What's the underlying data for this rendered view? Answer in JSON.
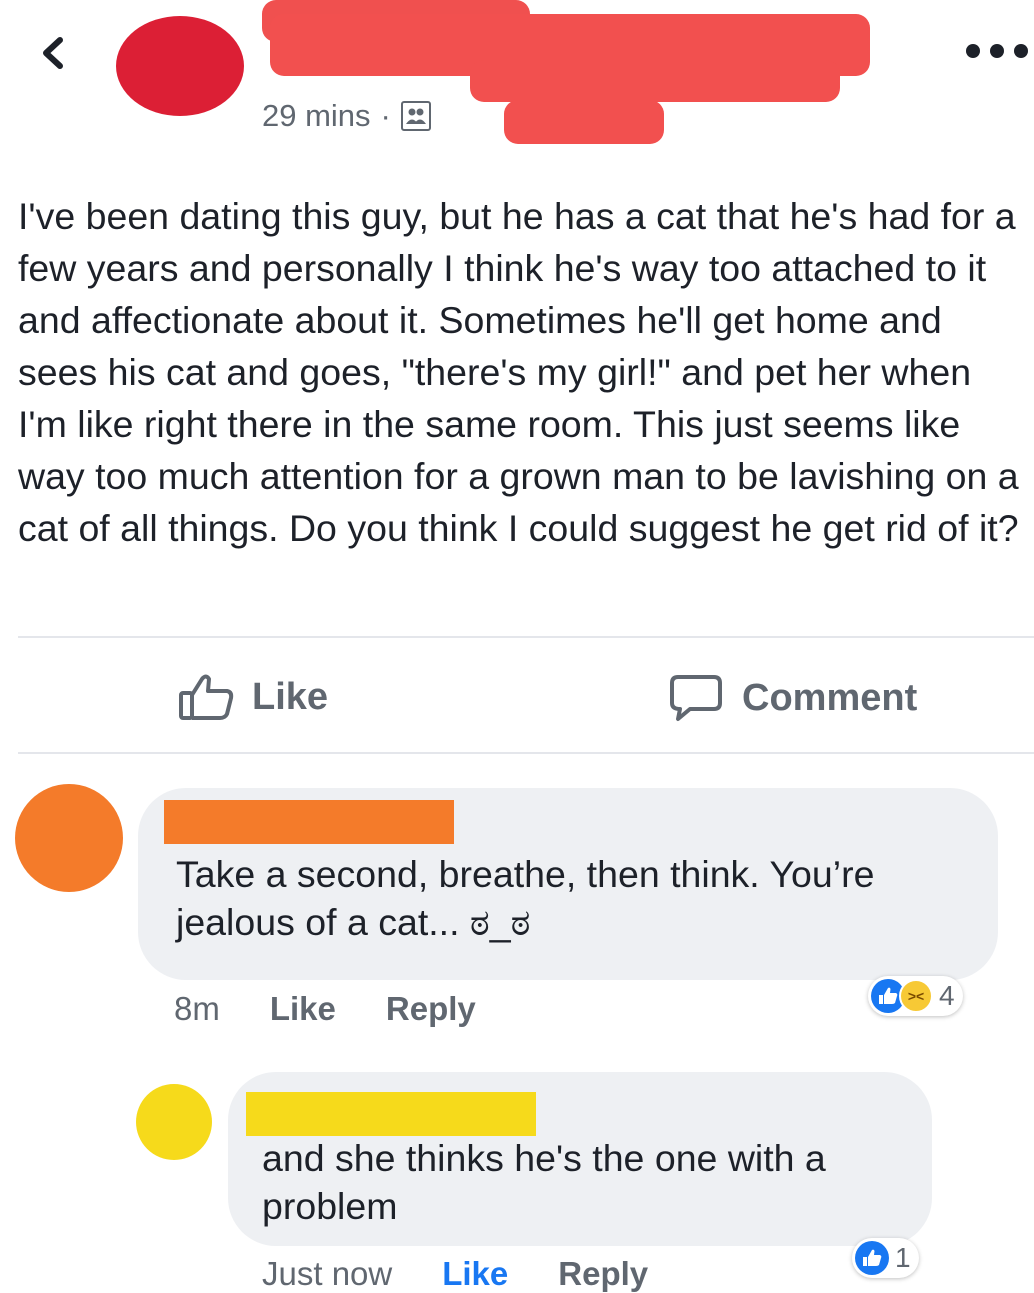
{
  "post": {
    "time": "29 mins",
    "separator": "·",
    "audience_icon": "friends-icon",
    "text": "I've been dating this guy, but he has a cat that he's had for a few years and personally I think he's way too attached to it and affectionate about it. Sometimes he'll get home and sees his cat and goes, \"there's my girl!\" and pet her when I'm like right there in the same room. This just seems like way too much attention for a grown man to be lavishing on a cat of all things. Do you think I could suggest he get rid of it?",
    "actions": {
      "like_label": "Like",
      "comment_label": "Comment"
    }
  },
  "comments": [
    {
      "text": "Take a second, breathe, then think. You’re jealous of a cat... ಠ_ಠ",
      "time": "8m",
      "like_label": "Like",
      "reply_label": "Reply",
      "reaction_count": "4",
      "reactions": [
        "like-icon",
        "haha-icon"
      ],
      "avatar_color": "#f47b2a"
    },
    {
      "text": "and she thinks he's the one with a problem",
      "time": "Just now",
      "like_label": "Like",
      "reply_label": "Reply",
      "reaction_count": "1",
      "reactions": [
        "like-icon"
      ],
      "avatar_color": "#f6da1b",
      "liked": true
    }
  ],
  "colors": {
    "accent_blue": "#1877f2",
    "redaction_red": "#f2504f",
    "redaction_orange": "#f47b2a",
    "redaction_yellow": "#f6da1b"
  }
}
